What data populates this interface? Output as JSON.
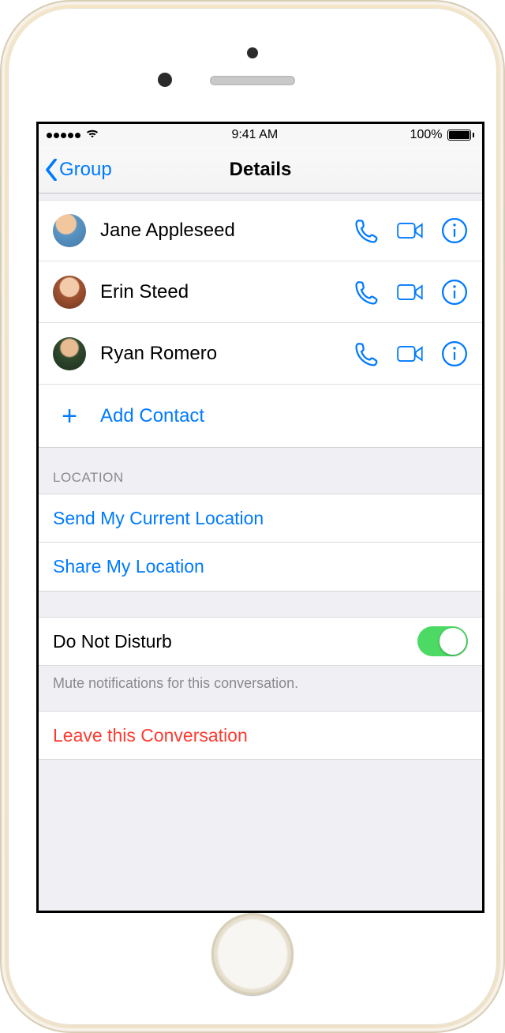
{
  "status": {
    "time": "9:41 AM",
    "battery_pct": "100%"
  },
  "nav": {
    "back_label": "Group",
    "title": "Details"
  },
  "contacts": [
    {
      "name": "Jane Appleseed"
    },
    {
      "name": "Erin Steed"
    },
    {
      "name": "Ryan Romero"
    }
  ],
  "add_contact_label": "Add Contact",
  "sections": {
    "location_header": "LOCATION",
    "send_location": "Send My Current Location",
    "share_location": "Share My Location",
    "dnd_label": "Do Not Disturb",
    "dnd_on": true,
    "dnd_note": "Mute notifications for this conversation.",
    "leave": "Leave this Conversation"
  },
  "colors": {
    "tint": "#007aff",
    "destructive": "#ff3b30",
    "switch_on": "#4cd964"
  }
}
